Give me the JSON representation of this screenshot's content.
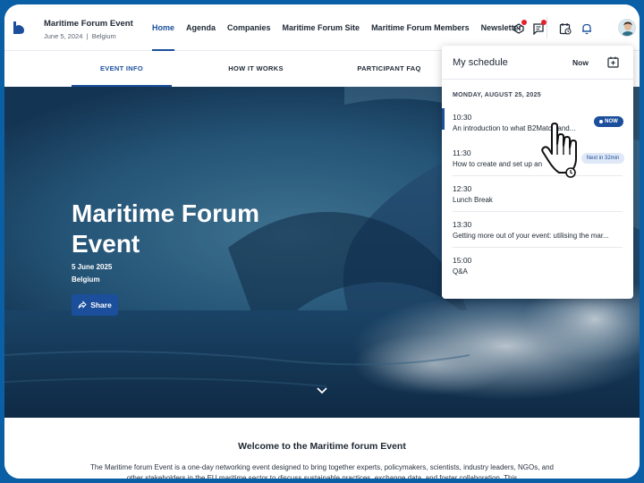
{
  "header": {
    "event_title": "Maritime Forum Event",
    "event_date": "June 5, 2024",
    "event_location": "Belgium",
    "nav": [
      {
        "label": "Home",
        "active": true
      },
      {
        "label": "Agenda",
        "active": false
      },
      {
        "label": "Companies",
        "active": false
      },
      {
        "label": "Maritime Forum Site",
        "active": false
      },
      {
        "label": "Maritime Forum Members",
        "active": false
      },
      {
        "label": "Newsletter",
        "active": false
      }
    ],
    "icons": [
      "ticket-icon",
      "chat-icon",
      "schedule-icon",
      "bell-icon",
      "avatar"
    ]
  },
  "subtabs": [
    {
      "label": "EVENT INFO",
      "active": true
    },
    {
      "label": "HOW IT WORKS",
      "active": false
    },
    {
      "label": "PARTICIPANT FAQ",
      "active": false
    }
  ],
  "hero": {
    "title": "Maritime Forum Event",
    "date": "5 June 2025",
    "location": "Belgium",
    "share_label": "Share"
  },
  "welcome": {
    "title": "Welcome to the Maritime forum Event",
    "text": "The Maritime forum Event is a one-day networking event designed to bring together experts, policymakers, scientists, industry leaders, NGOs, and other stakeholders in the EU maritime sector to discuss sustainable practices, exchange data, and foster collaboration. This"
  },
  "schedule": {
    "title": "My schedule",
    "now_label": "Now",
    "date_label": "MONDAY, AUGUST 25, 2025",
    "items": [
      {
        "time": "10:30",
        "title": "An introduction to what B2Match and...",
        "badge": "NOW"
      },
      {
        "time": "11:30",
        "title": "How to create and set up an",
        "badge": "Next in 32min"
      },
      {
        "time": "12:30",
        "title": "Lunch Break",
        "badge": ""
      },
      {
        "time": "13:30",
        "title": "Getting more out of your event: utilising the mar...",
        "badge": ""
      },
      {
        "time": "15:00",
        "title": "Q&A",
        "badge": ""
      }
    ]
  },
  "colors": {
    "accent": "#1b4f9c",
    "frame": "#0b5fa5",
    "notification": "#e5212c"
  }
}
